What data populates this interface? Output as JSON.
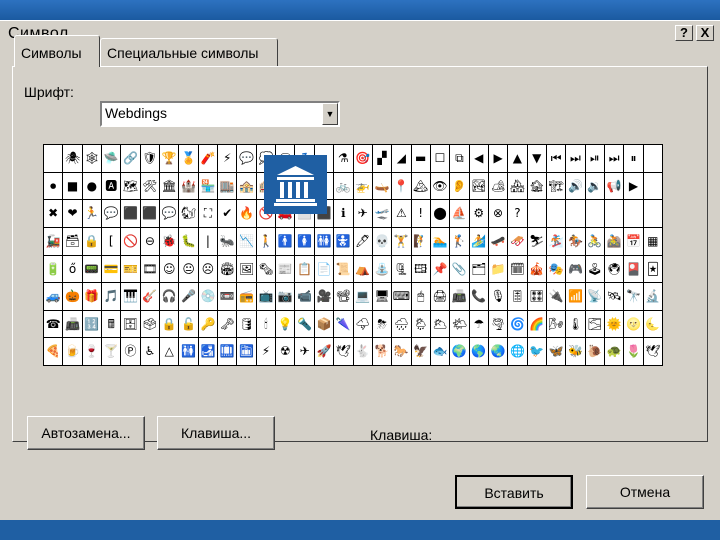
{
  "window": {
    "title": "Символ",
    "help_label": "?",
    "close_label": "X"
  },
  "tabs": [
    {
      "label": "Символы",
      "active": true
    },
    {
      "label": "Специальные символы",
      "active": false
    }
  ],
  "font": {
    "label": "Шрифт:",
    "value": "Webdings",
    "arrow": "▼"
  },
  "symbol_grid": {
    "rows": [
      [
        "",
        "🕷",
        "🕸",
        "🛸",
        "🔗",
        "🛡",
        "🏆",
        "🏅",
        "🧨",
        "⚡",
        "💬",
        "💭",
        "🗨",
        "💤",
        "",
        "⚗",
        "🎯",
        "▞",
        "◢",
        "▬",
        "☐",
        "⧉",
        "◀",
        "▶",
        "▲",
        "▼",
        "⏮",
        "⏭",
        "⏯",
        "⏭",
        "⏸",
        ""
      ],
      [
        "⏺",
        "■",
        "●",
        "🅰",
        "🗺",
        "🛠",
        "🏛",
        "🏰",
        "🏪",
        "🏬",
        "🏤",
        "🏨",
        "",
        "",
        "",
        "🚲",
        "🚁",
        "🛶",
        "📍",
        "🏔",
        "👁",
        "👂",
        "🏞",
        "🏕",
        "🏘",
        "🏚",
        "🏗",
        "🔊",
        "🔉",
        "📢",
        "▶",
        ""
      ],
      [
        "✖",
        "❤",
        "🏃",
        "💬",
        "⬛",
        "⬛",
        "💬",
        "🐿",
        "⛶",
        "✔",
        "🔥",
        "🚫",
        "🚗",
        "⬜",
        "⬛",
        "ℹ",
        "✈",
        "🛫",
        "⚠",
        "!",
        "⬤",
        "⛵",
        "⚙",
        "⊗",
        "?",
        "",
        "",
        "",
        "",
        "",
        "",
        ""
      ],
      [
        "🚂",
        "🗃",
        "🔒",
        "[",
        "🚫",
        "⊖",
        "🐞",
        "🐛",
        "|",
        "🐜",
        "📉",
        "🚶",
        "🚹",
        "🚺",
        "🚻",
        "🚼",
        "🖊",
        "💀",
        "🏋",
        "🧗",
        "🏊",
        "🏌",
        "🏄",
        "🛹",
        "🛷",
        "⛷",
        "🏂",
        "🏇",
        "🚴",
        "🚵",
        "📅",
        "▦"
      ],
      [
        "🔋",
        "ő",
        "📟",
        "💳",
        "🎫",
        "🎞",
        "☺",
        "😐",
        "☹",
        "🏟",
        "🖼",
        "🗞",
        "📰",
        "📋",
        "📄",
        "📜",
        "⛺",
        "⛲",
        "🗜",
        "🖽",
        "📌",
        "📎",
        "🗂",
        "📁",
        "🗓",
        "🎪",
        "🎭",
        "🎮",
        "🕹",
        "🖲",
        "🎴",
        "🃏"
      ],
      [
        "🚙",
        "🎃",
        "🎁",
        "🎵",
        "🎹",
        "🎸",
        "🎧",
        "🎤",
        "💿",
        "📼",
        "📻",
        "📺",
        "📷",
        "📹",
        "🎥",
        "📽",
        "💻",
        "🖥",
        "⌨",
        "🖱",
        "🖨",
        "📠",
        "📞",
        "🎙",
        "🎚",
        "🎛",
        "🔌",
        "📶",
        "📡",
        "🛰",
        "🔭",
        "🔬"
      ],
      [
        "☎",
        "📠",
        "🔢",
        "🖩",
        "🗄",
        "🗳",
        "🔒",
        "🔓",
        "🔑",
        "🗝",
        "🛢",
        "🕯",
        "💡",
        "🔦",
        "📦",
        "🌂",
        "🌩",
        "⛈",
        "🌧",
        "🌦",
        "🌥",
        "🌤",
        "☂",
        "🌪",
        "🌀",
        "🌈",
        "🌬",
        "🌡",
        "🌫",
        "🌞",
        "🌝",
        "🌜"
      ],
      [
        "🍕",
        "🍺",
        "🍷",
        "🍸",
        "Ⓟ",
        "♿",
        "△",
        "🚻",
        "🛃",
        "🛄",
        "🛅",
        "⚡",
        "☢",
        "✈",
        "🚀",
        "🕊",
        "🐇",
        "🐕",
        "🐎",
        "🦅",
        "🐟",
        "🌍",
        "🌎",
        "🌏",
        "🌐",
        "🐦",
        "🦋",
        "🐝",
        "🐌",
        "🐢",
        "🌷",
        "🕊"
      ]
    ],
    "zoomed_glyph": "🏛",
    "zoomed_glyph_name": "building-columns-icon"
  },
  "buttons": {
    "autocorrect": "Автозамена...",
    "shortcut_key": "Клавиша...",
    "insert": "Вставить",
    "cancel": "Отмена"
  },
  "shortcut": {
    "label": "Клавиша:"
  },
  "colors": {
    "dialog_bg": "#d4d0c8",
    "frame_blue": "#1f5fa3"
  }
}
